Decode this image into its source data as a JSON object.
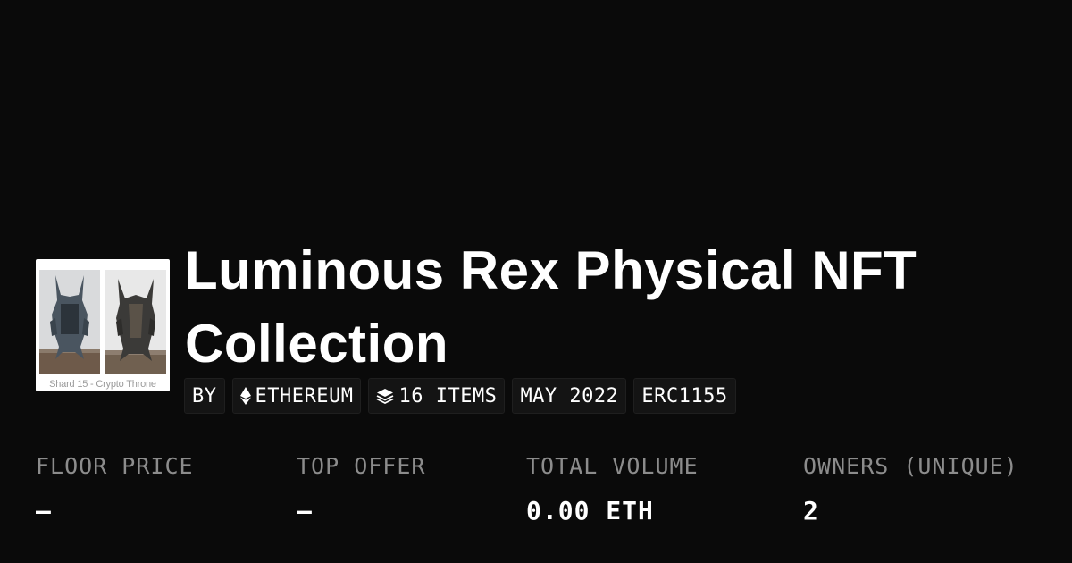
{
  "collection": {
    "title": "Luminous Rex Physical NFT Collection",
    "thumbnail_caption": "Shard 15 - Crypto Throne"
  },
  "tags": {
    "by": "BY",
    "chain": "ETHEREUM",
    "chain_icon": "ethereum-icon",
    "items": "16 ITEMS",
    "items_icon": "layers-icon",
    "date": "MAY 2022",
    "standard": "ERC1155"
  },
  "stats": {
    "floor_price": {
      "label": "FLOOR PRICE",
      "value": "–"
    },
    "top_offer": {
      "label": "TOP OFFER",
      "value": "–"
    },
    "total_volume": {
      "label": "TOTAL VOLUME",
      "value": "0.00 ETH"
    },
    "owners": {
      "label": "OWNERS (UNIQUE)",
      "value": "2"
    }
  },
  "colors": {
    "background": "#0a0a0a",
    "text": "#ffffff",
    "muted": "#8c8c8c",
    "tag_background": "#141414"
  }
}
